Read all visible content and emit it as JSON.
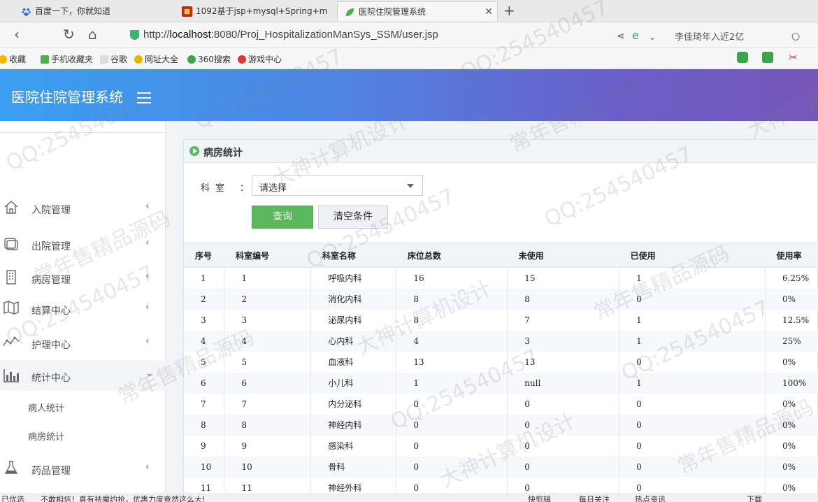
{
  "browser": {
    "tabs": [
      {
        "label": "百度一下，你就知道",
        "active": false
      },
      {
        "label": "1092基于jsp+mysql+Spring+m",
        "active": false
      },
      {
        "label": "医院住院管理系统",
        "active": true
      }
    ],
    "url_prefix": "http://",
    "url_host": "localhost",
    "url_rest": ":8080/Proj_HospitalizationManSys_SSM/user.jsp",
    "search_hint": "李佳琦年入近2亿",
    "bookmarks": [
      "收藏",
      "手机收藏夹",
      "谷歌",
      "网址大全",
      "360搜索",
      "游戏中心"
    ]
  },
  "app": {
    "title": "医院住院管理系统"
  },
  "sidebar": {
    "items": [
      {
        "label": "入院管理",
        "icon": "home-icon"
      },
      {
        "label": "出院管理",
        "icon": "copy-icon"
      },
      {
        "label": "病房管理",
        "icon": "building-icon"
      },
      {
        "label": "结算中心",
        "icon": "map-icon"
      },
      {
        "label": "护理中心",
        "icon": "pulse-icon"
      },
      {
        "label": "统计中心",
        "icon": "bar-chart-icon"
      },
      {
        "label": "药品管理",
        "icon": "flask-icon"
      }
    ],
    "subitems": [
      "病人统计",
      "病房统计"
    ]
  },
  "panel": {
    "title": "病房统计",
    "dept_label": "科室",
    "dept_colon": "：",
    "dept_select_value": "请选择",
    "query_button": "查询",
    "clear_button": "清空条件"
  },
  "table": {
    "headers": [
      "序号",
      "科室编号",
      "科室名称",
      "床位总数",
      "未使用",
      "已使用",
      "使用率"
    ],
    "rows": [
      [
        "1",
        "1",
        "呼吸内科",
        "16",
        "15",
        "1",
        "6.25%"
      ],
      [
        "2",
        "2",
        "消化内科",
        "8",
        "8",
        "0",
        "0%"
      ],
      [
        "3",
        "3",
        "泌尿内科",
        "8",
        "7",
        "1",
        "12.5%"
      ],
      [
        "4",
        "4",
        "心内科",
        "4",
        "3",
        "1",
        "25%"
      ],
      [
        "5",
        "5",
        "血液科",
        "13",
        "13",
        "0",
        "0%"
      ],
      [
        "6",
        "6",
        "小儿科",
        "1",
        "null",
        "1",
        "100%"
      ],
      [
        "7",
        "7",
        "内分泌科",
        "0",
        "0",
        "0",
        "0%"
      ],
      [
        "8",
        "8",
        "神经内科",
        "0",
        "0",
        "0",
        "0%"
      ],
      [
        "9",
        "9",
        "感染科",
        "0",
        "0",
        "0",
        "0%"
      ],
      [
        "10",
        "10",
        "骨科",
        "0",
        "0",
        "0",
        "0%"
      ],
      [
        "11",
        "11",
        "神经外科",
        "0",
        "0",
        "0",
        "0%"
      ]
    ]
  },
  "statusbar": {
    "left": "已优选",
    "news": "不敢相信！真有祛魔约抢，优惠力度竟然这么大!",
    "items": [
      "快剪辑",
      "每日关注",
      "热点资讯",
      "下载"
    ]
  },
  "watermarks": [
    "QQ:254540457",
    "常年售精品源码",
    "大神计算机设计"
  ]
}
